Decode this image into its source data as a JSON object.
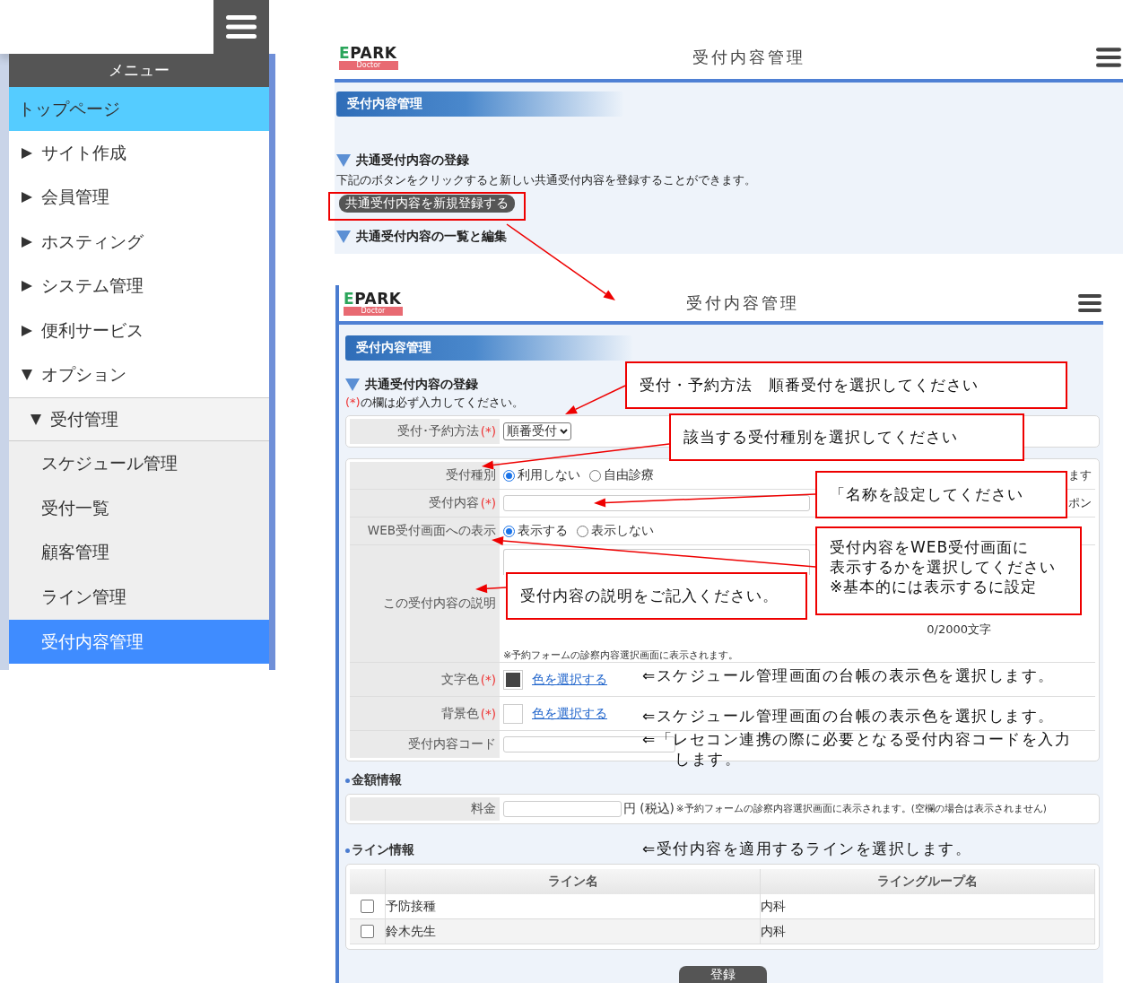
{
  "side_menu": {
    "title": "メニュー",
    "items": [
      {
        "label": "トップページ",
        "kind": "home"
      },
      {
        "label": "サイト作成",
        "kind": "folder",
        "expanded": false
      },
      {
        "label": "会員管理",
        "kind": "folder",
        "expanded": false
      },
      {
        "label": "ホスティング",
        "kind": "folder",
        "expanded": false
      },
      {
        "label": "システム管理",
        "kind": "folder",
        "expanded": false
      },
      {
        "label": "便利サービス",
        "kind": "folder",
        "expanded": false
      },
      {
        "label": "オプション",
        "kind": "folder",
        "expanded": true,
        "children": [
          {
            "label": "受付管理",
            "expanded": true,
            "children": [
              {
                "label": "スケジュール管理",
                "selected": false
              },
              {
                "label": "受付一覧",
                "selected": false
              },
              {
                "label": "顧客管理",
                "selected": false
              },
              {
                "label": "ライン管理",
                "selected": false
              },
              {
                "label": "受付内容管理",
                "selected": true
              }
            ]
          }
        ]
      }
    ]
  },
  "top_screen": {
    "logo": {
      "brand": "EPARK",
      "sub": "Doctor"
    },
    "title": "受付内容管理",
    "section_title": "受付内容管理",
    "heading_1": "共通受付内容の登録",
    "description": "下記のボタンをクリックすると新しい共通受付内容を登録することができます。",
    "new_button": "共通受付内容を新規登録する",
    "heading_2": "共通受付内容の一覧と編集"
  },
  "form_screen": {
    "logo": {
      "brand": "EPARK",
      "sub": "Doctor"
    },
    "title": "受付内容管理",
    "section_title": "受付内容管理",
    "heading": "共通受付内容の登録",
    "required_note": {
      "mark": "(*)",
      "text": "の欄は必ず入力してください。"
    },
    "method_row": {
      "label": "受付･予約方法",
      "required_mark": "(*)",
      "value": "順番受付"
    },
    "rows": [
      {
        "kind": "radio",
        "label": "受付種別",
        "options": [
          {
            "label": "利用しない",
            "selected": true
          },
          {
            "label": "自由診療",
            "selected": false
          }
        ],
        "note": "ます"
      },
      {
        "kind": "text",
        "label": "受付内容",
        "required_mark": "(*)",
        "note": "ポン"
      },
      {
        "kind": "radio",
        "label": "WEB受付画面への表示",
        "options": [
          {
            "label": "表示する",
            "selected": true
          },
          {
            "label": "表示しない",
            "selected": false
          }
        ]
      },
      {
        "kind": "textarea",
        "label": "この受付内容の説明",
        "counter": "0/2000文字",
        "help": "※予約フォームの診察内容選択画面に表示されます。"
      },
      {
        "kind": "color",
        "label": "文字色",
        "required_mark": "(*)",
        "color": "#444444",
        "link": "色を選択する"
      },
      {
        "kind": "color",
        "label": "背景色",
        "required_mark": "(*)",
        "color": "#ffffff",
        "link": "色を選択する"
      },
      {
        "kind": "text",
        "label": "受付内容コード"
      }
    ],
    "price": {
      "heading": "金額情報",
      "label": "料金",
      "unit": "円 (税込)",
      "note": "※予約フォームの診察内容選択画面に表示されます。(空欄の場合は表示されません)"
    },
    "lines": {
      "heading": "ライン情報",
      "columns": [
        "ライン名",
        "ライングループ名"
      ],
      "rows": [
        {
          "checked": false,
          "cells": [
            "予防接種",
            "内科"
          ]
        },
        {
          "checked": false,
          "cells": [
            "鈴木先生",
            "内科"
          ]
        }
      ]
    },
    "submit_button": "登録"
  },
  "annotations": {
    "callouts": [
      {
        "lines": [
          "受付・予約方法　順番受付を選択してください"
        ]
      },
      {
        "lines": [
          "該当する受付種別を選択してください"
        ]
      },
      {
        "lines": [
          "「名称を設定してください"
        ]
      },
      {
        "lines": [
          "受付内容をWEB受付画面に",
          "表示するかを選択してください",
          "※基本的には表示するに設定"
        ]
      },
      {
        "lines": [
          "受付内容の説明をご記入ください。"
        ]
      }
    ],
    "notes": [
      {
        "lines": [
          "⇐スケジュール管理画面の台帳の表示色を選択します。"
        ]
      },
      {
        "lines": [
          "⇐スケジュール管理画面の台帳の表示色を選択します。"
        ]
      },
      {
        "lines": [
          "⇐「レセコン連携の際に必要となる受付内容コードを入力",
          "します。"
        ]
      },
      {
        "lines": [
          "⇐受付内容を適用するラインを選択します。"
        ]
      }
    ]
  }
}
